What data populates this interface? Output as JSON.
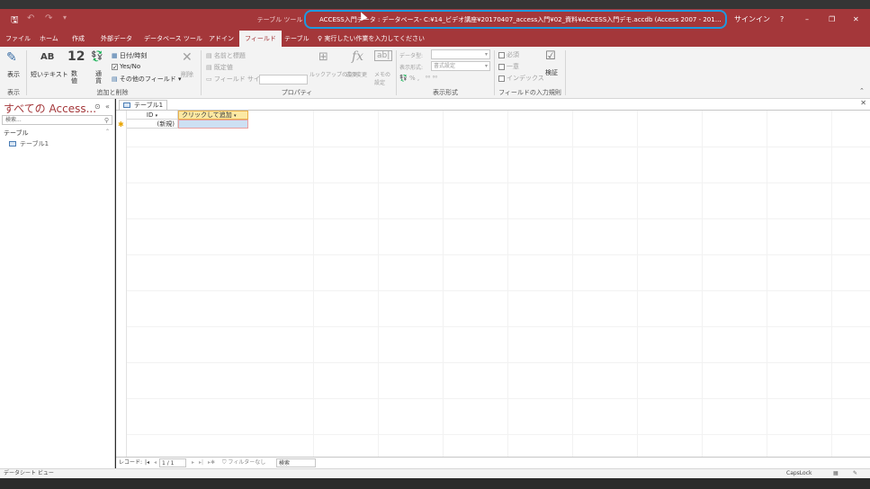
{
  "titlebar": {
    "save_icon": "save-icon",
    "undo_icon": "undo-icon",
    "redo_icon": "redo-icon",
    "context_tab_title": "テーブル ツール",
    "window_title": "ACCESS入門データ : データベース- C:¥14_ビデオ講座¥20170407_access入門¥02_資料¥ACCESS入門デモ.accdb (Access 2007 - 2016 ファイ…",
    "signin": "サインイン",
    "help": "?",
    "minimize": "–",
    "restore": "❐",
    "close": "✕",
    "highlight_color": "#1e9ae0"
  },
  "tabs": {
    "file": "ファイル",
    "home": "ホーム",
    "create": "作成",
    "external": "外部データ",
    "dbtools": "データベース ツール",
    "addins": "アドイン",
    "fields": "フィールド",
    "table": "テーブル",
    "tell_me": "実行したい作業を入力してください"
  },
  "ribbon": {
    "view_label": "表示",
    "view_group": "表示",
    "short_text": "短いテキスト",
    "number": "数値",
    "currency": "通貨",
    "datetime": "日付/時刻",
    "yesno": "Yes/No",
    "more_fields": "その他のフィールド",
    "delete": "削除",
    "add_delete_group": "追加と削除",
    "name_caption": "名前と標題",
    "default_value": "既定値",
    "field_size": "フィールド サイズ",
    "lookup_change": "ルックアップの変更",
    "expression_change": "式の変更",
    "memo_settings": "メモの設定",
    "properties_group": "プロパティ",
    "data_type": "データ型:",
    "format": "表示形式:",
    "format_value": "書式設定",
    "percent": "%",
    "format_group": "表示形式",
    "required": "必須",
    "unique": "一意",
    "indexed": "インデックス",
    "validation": "検証",
    "validation_group": "フィールドの入力規則"
  },
  "nav": {
    "title": "すべての Access...",
    "search_placeholder": "検索...",
    "group": "テーブル",
    "item": "テーブル1"
  },
  "document": {
    "tab": "テーブル1",
    "col_id": "ID",
    "col_add": "クリックして追加",
    "new_row": "(新規)"
  },
  "recnav": {
    "label": "レコード:",
    "position": "1 / 1",
    "filter": "フィルターなし",
    "search": "検索"
  },
  "status": {
    "left": "データシート ビュー",
    "capslock": "CapsLock"
  }
}
